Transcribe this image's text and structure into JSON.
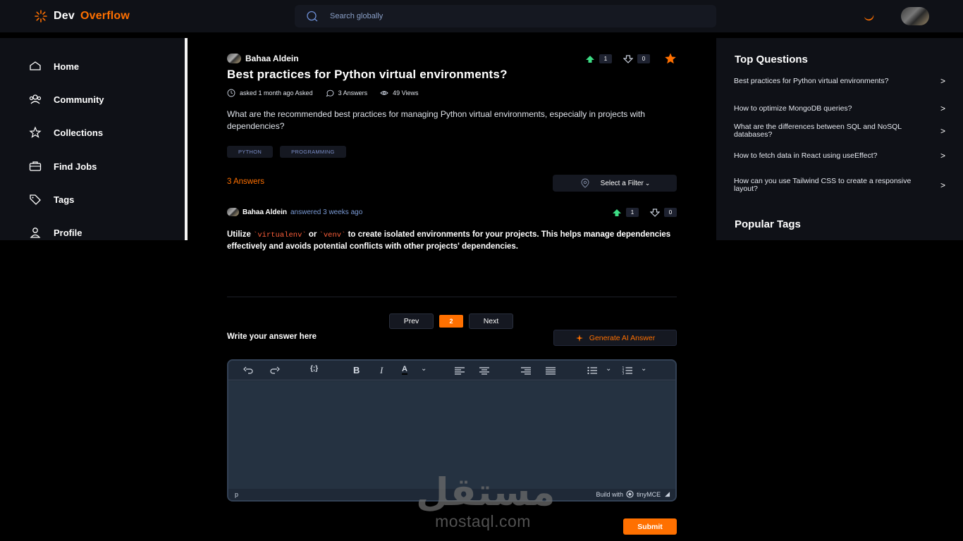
{
  "brand": {
    "part1": "Dev",
    "part2": "Overflow",
    "accent": "#ff7000"
  },
  "search": {
    "placeholder": "Search globally"
  },
  "sidebar": {
    "items": [
      {
        "label": "Home",
        "icon": "home-icon"
      },
      {
        "label": "Community",
        "icon": "users-icon"
      },
      {
        "label": "Collections",
        "icon": "star-icon"
      },
      {
        "label": "Find Jobs",
        "icon": "briefcase-icon"
      },
      {
        "label": "Tags",
        "icon": "tag-icon"
      },
      {
        "label": "Profile",
        "icon": "user-icon"
      }
    ]
  },
  "question": {
    "author": "Bahaa Aldein",
    "title": "Best practices for Python virtual environments?",
    "asked": "asked 1 month ago Asked",
    "answers": "3 Answers",
    "views": "49 Views",
    "upvotes": "1",
    "downvotes": "0",
    "body": "What are the recommended best practices for managing Python virtual environments, especially in projects with dependencies?",
    "tags": [
      "PYTHON",
      "PROGRAMMING"
    ]
  },
  "answers_section": {
    "count_label": "3 Answers",
    "filter_label": "Select a Filter"
  },
  "answer": {
    "author": "Bahaa Aldein",
    "when": "answered 3 weeks ago",
    "upvotes": "1",
    "downvotes": "0",
    "text_1": "Utilize ",
    "code_1": "`virtualenv`",
    "text_2": " or ",
    "code_2": "`venv`",
    "text_3": " to create isolated environments for your projects. This helps manage dependencies effectively and avoids potential conflicts with other projects' dependencies."
  },
  "pagination": {
    "prev": "Prev",
    "current": "2",
    "next": "Next"
  },
  "composer": {
    "label": "Write your answer here",
    "ai_button": "Generate AI Answer",
    "status_path": "p",
    "build_with": "Build with",
    "editor_brand": "tinyMCE",
    "submit": "Submit"
  },
  "right_sidebar": {
    "top_title": "Top Questions",
    "top_questions": [
      "Best practices for Python virtual environments?",
      "How to optimize MongoDB queries?",
      "What are the differences between SQL and NoSQL databases?",
      "How to fetch data in React using useEffect?",
      "How can you use Tailwind CSS to create a responsive layout?"
    ],
    "tags_title": "Popular Tags"
  },
  "watermark": {
    "arabic": "مستقل",
    "latin": "mostaql.com"
  }
}
